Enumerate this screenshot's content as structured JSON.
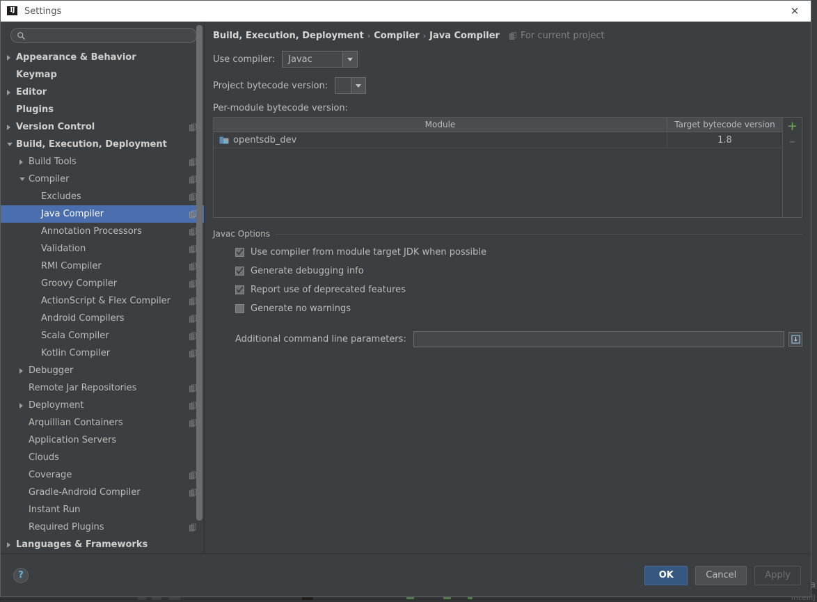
{
  "window": {
    "title": "Settings",
    "logo_text": "IJ",
    "close_label": "✕"
  },
  "sidebar": {
    "search": {
      "value": "",
      "placeholder": "",
      "icon": "search-icon"
    },
    "items": [
      {
        "label": "Appearance & Behavior",
        "level": 0,
        "bold": true,
        "arrow": "closed",
        "cfg": false,
        "selected": false
      },
      {
        "label": "Keymap",
        "level": 0,
        "bold": true,
        "arrow": "none",
        "cfg": false,
        "selected": false
      },
      {
        "label": "Editor",
        "level": 0,
        "bold": true,
        "arrow": "closed",
        "cfg": false,
        "selected": false
      },
      {
        "label": "Plugins",
        "level": 0,
        "bold": true,
        "arrow": "none",
        "cfg": false,
        "selected": false
      },
      {
        "label": "Version Control",
        "level": 0,
        "bold": true,
        "arrow": "closed",
        "cfg": true,
        "selected": false
      },
      {
        "label": "Build, Execution, Deployment",
        "level": 0,
        "bold": true,
        "arrow": "open",
        "cfg": false,
        "selected": false
      },
      {
        "label": "Build Tools",
        "level": 1,
        "bold": false,
        "arrow": "closed",
        "cfg": true,
        "selected": false
      },
      {
        "label": "Compiler",
        "level": 1,
        "bold": false,
        "arrow": "open",
        "cfg": true,
        "selected": false
      },
      {
        "label": "Excludes",
        "level": 2,
        "bold": false,
        "arrow": "none",
        "cfg": true,
        "selected": false
      },
      {
        "label": "Java Compiler",
        "level": 2,
        "bold": false,
        "arrow": "none",
        "cfg": true,
        "selected": true
      },
      {
        "label": "Annotation Processors",
        "level": 2,
        "bold": false,
        "arrow": "none",
        "cfg": true,
        "selected": false
      },
      {
        "label": "Validation",
        "level": 2,
        "bold": false,
        "arrow": "none",
        "cfg": true,
        "selected": false
      },
      {
        "label": "RMI Compiler",
        "level": 2,
        "bold": false,
        "arrow": "none",
        "cfg": true,
        "selected": false
      },
      {
        "label": "Groovy Compiler",
        "level": 2,
        "bold": false,
        "arrow": "none",
        "cfg": true,
        "selected": false
      },
      {
        "label": "ActionScript & Flex Compiler",
        "level": 2,
        "bold": false,
        "arrow": "none",
        "cfg": true,
        "selected": false
      },
      {
        "label": "Android Compilers",
        "level": 2,
        "bold": false,
        "arrow": "none",
        "cfg": true,
        "selected": false
      },
      {
        "label": "Scala Compiler",
        "level": 2,
        "bold": false,
        "arrow": "none",
        "cfg": true,
        "selected": false
      },
      {
        "label": "Kotlin Compiler",
        "level": 2,
        "bold": false,
        "arrow": "none",
        "cfg": true,
        "selected": false
      },
      {
        "label": "Debugger",
        "level": 1,
        "bold": false,
        "arrow": "closed",
        "cfg": false,
        "selected": false
      },
      {
        "label": "Remote Jar Repositories",
        "level": 1,
        "bold": false,
        "arrow": "none",
        "cfg": true,
        "selected": false
      },
      {
        "label": "Deployment",
        "level": 1,
        "bold": false,
        "arrow": "closed",
        "cfg": true,
        "selected": false
      },
      {
        "label": "Arquillian Containers",
        "level": 1,
        "bold": false,
        "arrow": "none",
        "cfg": true,
        "selected": false
      },
      {
        "label": "Application Servers",
        "level": 1,
        "bold": false,
        "arrow": "none",
        "cfg": false,
        "selected": false
      },
      {
        "label": "Clouds",
        "level": 1,
        "bold": false,
        "arrow": "none",
        "cfg": false,
        "selected": false
      },
      {
        "label": "Coverage",
        "level": 1,
        "bold": false,
        "arrow": "none",
        "cfg": true,
        "selected": false
      },
      {
        "label": "Gradle-Android Compiler",
        "level": 1,
        "bold": false,
        "arrow": "none",
        "cfg": true,
        "selected": false
      },
      {
        "label": "Instant Run",
        "level": 1,
        "bold": false,
        "arrow": "none",
        "cfg": false,
        "selected": false
      },
      {
        "label": "Required Plugins",
        "level": 1,
        "bold": false,
        "arrow": "none",
        "cfg": true,
        "selected": false
      },
      {
        "label": "Languages & Frameworks",
        "level": 0,
        "bold": true,
        "arrow": "closed",
        "cfg": false,
        "selected": false
      }
    ]
  },
  "content": {
    "breadcrumb": {
      "crumb1": "Build, Execution, Deployment",
      "sep1": "›",
      "crumb2": "Compiler",
      "sep2": "›",
      "crumb3": "Java Compiler",
      "scope_label": "For current project",
      "scope_icon": "project-scope-icon"
    },
    "use_compiler": {
      "label": "Use compiler:",
      "value": "Javac"
    },
    "project_bytecode": {
      "label": "Project bytecode version:",
      "value": ""
    },
    "per_module_label": "Per-module bytecode version:",
    "module_table": {
      "columns": [
        "Module",
        "Target bytecode version"
      ],
      "rows": [
        {
          "module": "opentsdb_dev",
          "module_icon": "module-icon",
          "target": "1.8"
        }
      ],
      "add_button": "+",
      "remove_button": "–"
    },
    "javac_options": {
      "title": "Javac Options",
      "checkboxes": [
        {
          "label": "Use compiler from module target JDK when possible",
          "checked": true
        },
        {
          "label": "Generate debugging info",
          "checked": true
        },
        {
          "label": "Report use of deprecated features",
          "checked": true
        },
        {
          "label": "Generate no warnings",
          "checked": false
        }
      ],
      "additional_params": {
        "label": "Additional command line parameters:",
        "value": "",
        "placeholder": "",
        "expand_icon": "expand-editor-icon"
      }
    }
  },
  "footer": {
    "help_label": "?",
    "ok_label": "OK",
    "cancel_label": "Cancel",
    "apply_label": "Apply"
  },
  "highlight": {
    "color": "#f01e14",
    "target": "target-bytecode-version-column"
  },
  "background": {
    "right_edge_text": "IntelliJ",
    "right_edge_a": "a"
  }
}
